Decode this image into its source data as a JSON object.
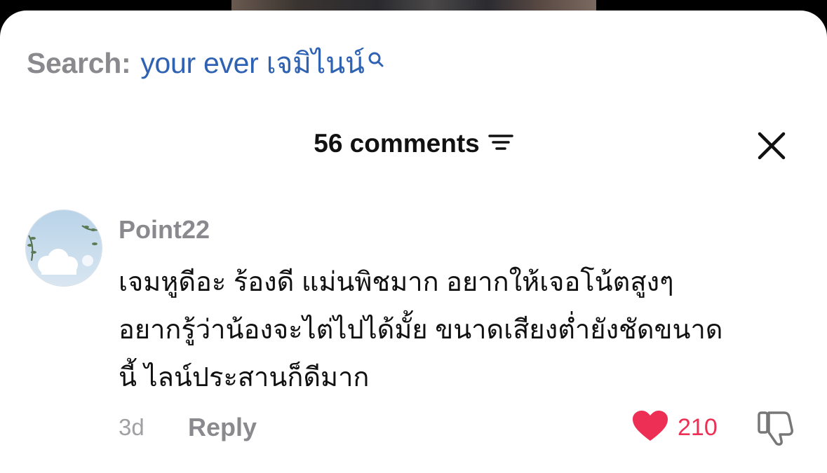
{
  "search": {
    "prefix": "Search:",
    "query": "your ever เจมิไนน์"
  },
  "header": {
    "comments_count": "56 comments"
  },
  "comment": {
    "username": "Point22",
    "text_lines": [
      "เจมหูดีอะ ร้องดี แม่นพิชมาก อยากให้เจอโน้ตสูงๆ",
      "อยากรู้ว่าน้องจะไต่ไปได้มั้ย ขนาดเสียงต่ำยังชัดขนาด",
      "นี้ ไลน์ประสานก็ดีมาก"
    ],
    "time": "3d",
    "reply_label": "Reply",
    "likes": "210",
    "liked": true
  },
  "colors": {
    "accent_blue": "#2f62b3",
    "like_red": "#ee2f55",
    "muted_gray": "#8a8a8e"
  },
  "icons": {
    "search": "search-icon",
    "sort": "sort-icon",
    "close": "close-icon",
    "like": "heart-icon",
    "dislike": "thumbs-down-icon"
  }
}
